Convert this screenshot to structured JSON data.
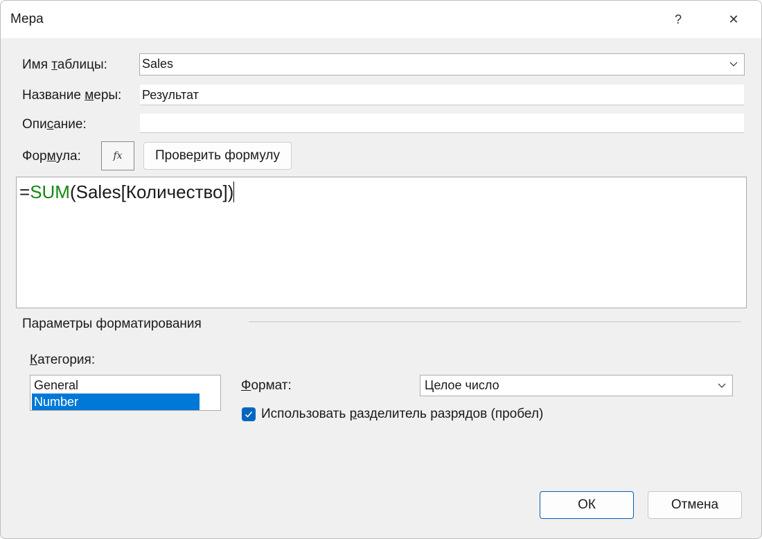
{
  "window": {
    "title": "Мера",
    "help_label": "?",
    "close_label": "✕"
  },
  "form": {
    "table_name_label_pre": "Имя ",
    "table_name_label_ul": "т",
    "table_name_label_post": "аблицы:",
    "table_name_value": "Sales",
    "measure_name_label_pre": "Название ",
    "measure_name_label_ul": "м",
    "measure_name_label_post": "еры:",
    "measure_name_value": "Результат",
    "description_label_pre": "Опи",
    "description_label_ul": "с",
    "description_label_post": "ание:",
    "description_value": "",
    "formula_label_pre": "Фор",
    "formula_label_ul": "м",
    "formula_label_post": "ула:",
    "fx_label": "fx",
    "check_formula_pre": "Прове",
    "check_formula_ul": "р",
    "check_formula_post": "ить формулу"
  },
  "formula": {
    "prefix": "=",
    "function": "SUM",
    "args": "(Sales[Количество])",
    "function_color": "#118811"
  },
  "formatting": {
    "section_title": "Параметры форматирования",
    "category_label_ul": "К",
    "category_label_post": "атегория:",
    "categories": [
      "General",
      "Number"
    ],
    "selected_category": "Number",
    "format_label_ul": "Ф",
    "format_label_post": "ормат:",
    "format_value": "Целое число",
    "separator_checked": true,
    "separator_label_pre": "Использовать ",
    "separator_label_ul": "р",
    "separator_label_post": "азделитель разрядов (пробел)"
  },
  "buttons": {
    "ok": "ОК",
    "cancel": "Отмена"
  },
  "colors": {
    "accent": "#0067c0",
    "selection": "#0078d7"
  }
}
